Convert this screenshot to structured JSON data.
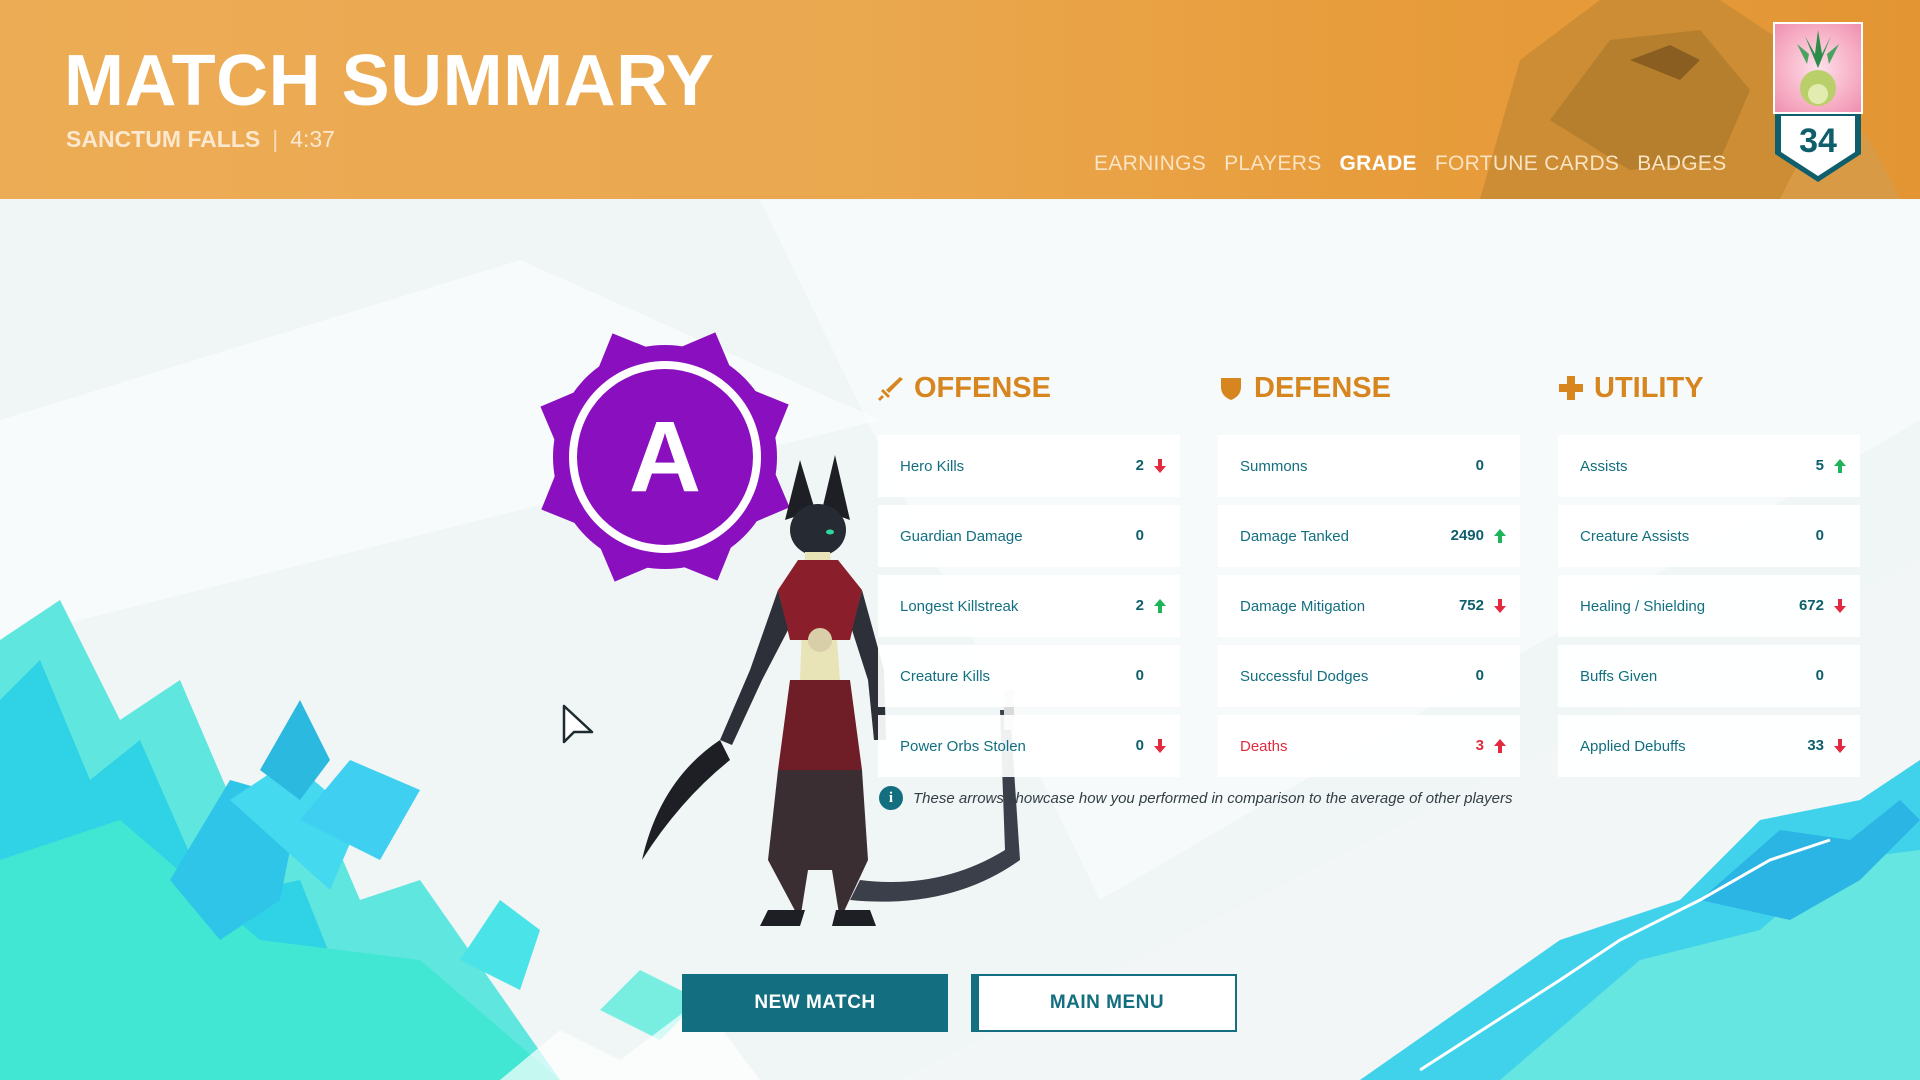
{
  "header": {
    "title": "MATCH SUMMARY",
    "map_name": "SANCTUM FALLS",
    "separator": "|",
    "duration": "4:37",
    "nav": [
      {
        "label": "EARNINGS",
        "active": false
      },
      {
        "label": "PLAYERS",
        "active": false
      },
      {
        "label": "GRADE",
        "active": true
      },
      {
        "label": "FORTUNE CARDS",
        "active": false
      },
      {
        "label": "BADGES",
        "active": false
      }
    ],
    "level": "34"
  },
  "grade": {
    "letter": "A",
    "color": "#8a0fbf"
  },
  "columns": {
    "offense": {
      "title": "OFFENSE",
      "icon": "sword-icon",
      "rows": [
        {
          "label": "Hero Kills",
          "value": "2",
          "trend": "down"
        },
        {
          "label": "Guardian Damage",
          "value": "0",
          "trend": "none"
        },
        {
          "label": "Longest Killstreak",
          "value": "2",
          "trend": "up"
        },
        {
          "label": "Creature Kills",
          "value": "0",
          "trend": "none"
        },
        {
          "label": "Power Orbs Stolen",
          "value": "0",
          "trend": "down"
        }
      ]
    },
    "defense": {
      "title": "DEFENSE",
      "icon": "shield-icon",
      "rows": [
        {
          "label": "Summons",
          "value": "0",
          "trend": "none"
        },
        {
          "label": "Damage Tanked",
          "value": "2490",
          "trend": "up"
        },
        {
          "label": "Damage Mitigation",
          "value": "752",
          "trend": "down"
        },
        {
          "label": "Successful Dodges",
          "value": "0",
          "trend": "none"
        },
        {
          "label": "Deaths",
          "value": "3",
          "trend": "up-bad"
        }
      ]
    },
    "utility": {
      "title": "UTILITY",
      "icon": "plus-icon",
      "rows": [
        {
          "label": "Assists",
          "value": "5",
          "trend": "up"
        },
        {
          "label": "Creature Assists",
          "value": "0",
          "trend": "none"
        },
        {
          "label": "Healing / Shielding",
          "value": "672",
          "trend": "down"
        },
        {
          "label": "Buffs Given",
          "value": "0",
          "trend": "none"
        },
        {
          "label": "Applied Debuffs",
          "value": "33",
          "trend": "down"
        }
      ]
    }
  },
  "info_note": "These arrows showcase how you performed in comparison to the average of other players",
  "buttons": {
    "new_match": "NEW MATCH",
    "main_menu": "MAIN MENU"
  },
  "colors": {
    "accent_orange": "#d7861f",
    "teal": "#136f80",
    "arrow_up": "#1fb35a",
    "arrow_down": "#e2293f",
    "grade_purple": "#8a0fbf"
  }
}
